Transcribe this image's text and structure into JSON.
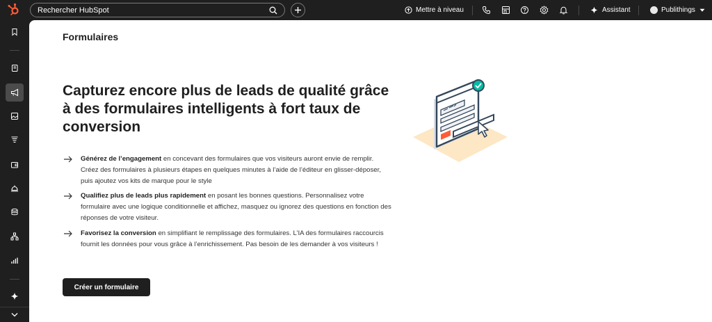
{
  "topbar": {
    "search_placeholder": "Rechercher HubSpot",
    "upgrade_label": "Mettre à niveau",
    "assistant_label": "Assistant",
    "account_name": "Publithings"
  },
  "page": {
    "title": "Formulaires",
    "headline": "Capturez encore plus de leads de qualité grâce à des formulaires intelligents à fort taux de conversion",
    "features": [
      {
        "strong": "Générez de l’engagement",
        "text": " en concevant des formulaires que vos visiteurs auront envie de remplir. Créez des formulaires à plusieurs étapes en quelques minutes à l’aide de l’éditeur en glisser-déposer, puis ajoutez vos kits de marque pour le style"
      },
      {
        "strong": "Qualifiez plus de leads plus rapidement",
        "text": " en posant les bonnes questions. Personnalisez votre formulaire avec une logique conditionnelle et affichez, masquez ou ignorez des questions en fonction des réponses de votre visiteur."
      },
      {
        "strong": "Favorisez la conversion",
        "text": " en simplifiant le remplissage des formulaires. L’IA des formulaires raccourcis fournit les données pour vous grâce à l’enrichissement. Pas besoin de les demander à vos visiteurs !"
      }
    ],
    "cta_label": "Créer un formulaire"
  },
  "colors": {
    "brand_orange": "#ff5c35",
    "topbar_bg": "#1f1f1f",
    "accent_teal": "#00bda5",
    "illustration_base": "#fde7c4"
  }
}
